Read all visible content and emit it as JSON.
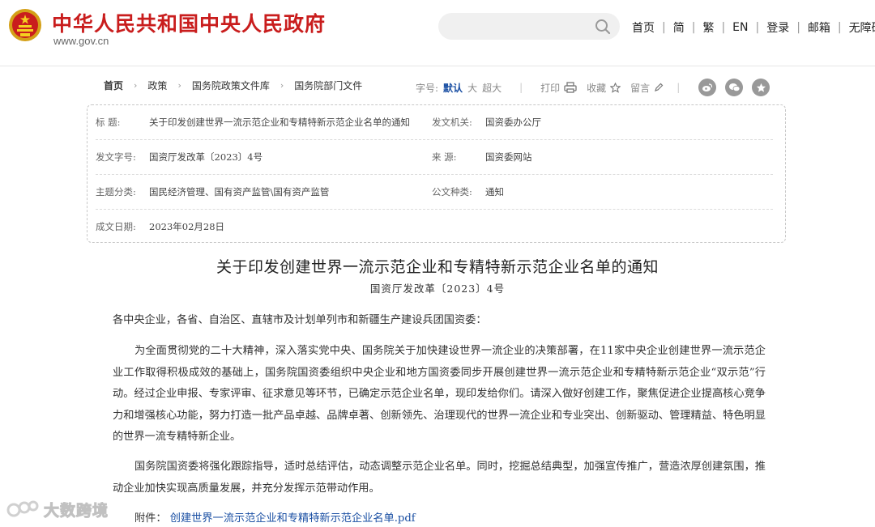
{
  "header": {
    "site_title": "中华人民共和国中央人民政府",
    "site_domain": "www.gov.cn",
    "search": {
      "placeholder": "",
      "icon": "search-icon"
    },
    "nav": [
      "首页",
      "简",
      "繁",
      "EN",
      "登录",
      "邮箱",
      "无障碍"
    ],
    "brand_color": "#c91d1d"
  },
  "breadcrumb": [
    "首页",
    "政策",
    "国务院政策文件库",
    "国务院部门文件"
  ],
  "tools": {
    "font_label": "字号:",
    "font_sizes": [
      "默认",
      "大",
      "超大"
    ],
    "print": "打印",
    "favorite": "收藏",
    "comment": "留言",
    "share_icons": [
      "weibo-icon",
      "wechat-icon",
      "favorite-star-icon"
    ]
  },
  "meta": {
    "title_label": "标 题:",
    "title_value": "关于印发创建世界一流示范企业和专精特新示范企业名单的通知",
    "issuer_label": "发文机关:",
    "issuer_value": "国资委办公厅",
    "doc_no_label": "发文字号:",
    "doc_no_value": "国资厅发改革〔2023〕4号",
    "source_label": "来 源:",
    "source_value": "国资委网站",
    "category_label": "主题分类:",
    "category_value": "国民经济管理、国有资产监管\\国有资产监管",
    "type_label": "公文种类:",
    "type_value": "通知",
    "date_label": "成文日期:",
    "date_value": "2023年02月28日"
  },
  "article": {
    "title": "关于印发创建世界一流示范企业和专精特新示范企业名单的通知",
    "doc_no": "国资厅发改革〔2023〕4号",
    "salutation": "各中央企业，各省、自治区、直辖市及计划单列市和新疆生产建设兵团国资委：",
    "paragraphs": [
      "为全面贯彻党的二十大精神，深入落实党中央、国务院关于加快建设世界一流企业的决策部署，在11家中央企业创建世界一流示范企业工作取得积极成效的基础上，国务院国资委组织中央企业和地方国资委同步开展创建世界一流示范企业和专精特新示范企业“双示范”行动。经过企业申报、专家评审、征求意见等环节，已确定示范企业名单，现印发给你们。请深入做好创建工作，聚焦促进企业提高核心竞争力和增强核心功能，努力打造一批产品卓越、品牌卓著、创新领先、治理现代的世界一流企业和专业突出、创新驱动、管理精益、特色明显的世界一流专精特新企业。",
      "国务院国资委将强化跟踪指导，适时总结评估，动态调整示范企业名单。同时，挖掘总结典型，加强宣传推广，营造浓厚创建氛围，推动企业加快实现高质量发展，并充分发挥示范带动作用。"
    ],
    "attachment_label": "附件：",
    "attachment_link": "创建世界一流示范企业和专精特新示范企业名单.pdf"
  },
  "watermark": "大数跨境"
}
